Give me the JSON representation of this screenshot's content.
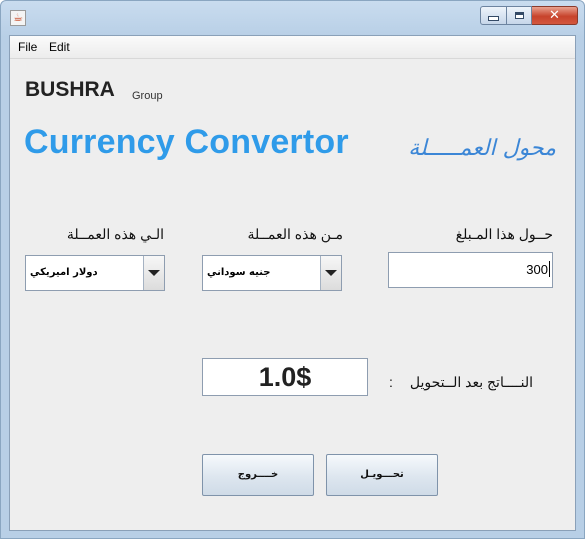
{
  "menu": {
    "file": "File",
    "edit": "Edit"
  },
  "branding": {
    "name": "BUSHRA",
    "group": "Group"
  },
  "headline": "Currency Convertor",
  "arabic_title": "محول العمـــــلة",
  "labels": {
    "amount": "حــول هذا المـبلغ",
    "from_currency": "مـن هذه العمــلة",
    "to_currency": "الـي هذه العمــلة",
    "result": "النــــاتج بعد الــتحويل",
    "colon": ":"
  },
  "fields": {
    "amount_value": "300",
    "from_currency_value": "جنيه سوداني",
    "to_currency_value": "دولار اميريكي",
    "result_value": "1.0$"
  },
  "buttons": {
    "convert": "تحـــويـل",
    "exit": "خــــروج"
  },
  "colors": {
    "headline": "#2f9be9",
    "arabic_title": "#3b86d6",
    "close_button": "#c7432c"
  },
  "icons": {
    "app": "java-icon",
    "minimize": "minimize-icon",
    "maximize": "maximize-icon",
    "close": "close-icon",
    "dropdown": "chevron-down-icon"
  }
}
